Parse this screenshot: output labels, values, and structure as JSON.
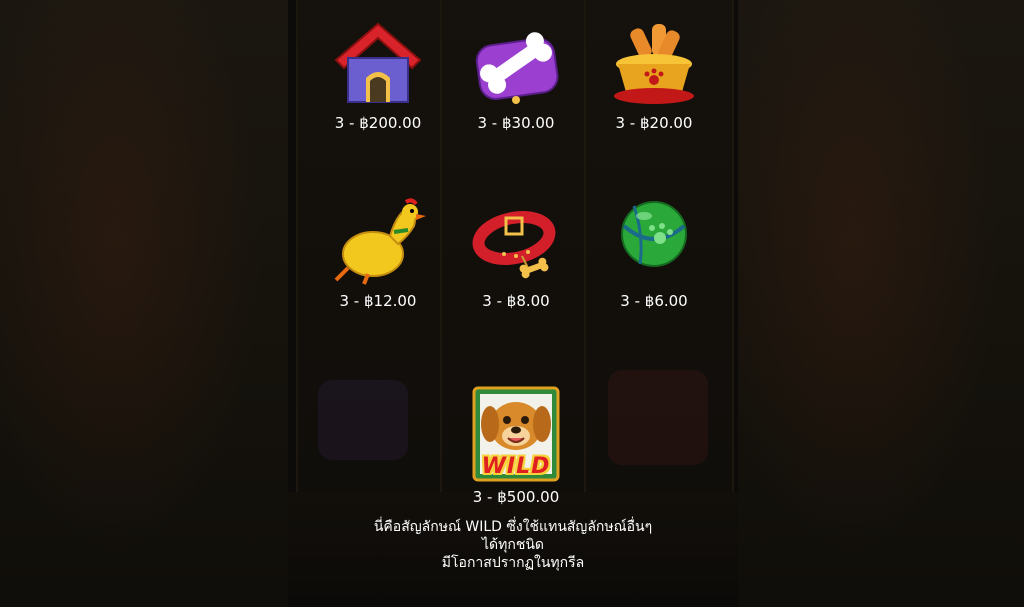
{
  "paytable": {
    "rows": [
      [
        {
          "icon": "dog-house-icon",
          "payout": "3 - ฿200.00"
        },
        {
          "icon": "bone-pillow-icon",
          "payout": "3 - ฿30.00"
        },
        {
          "icon": "dog-bowl-icon",
          "payout": "3 - ฿20.00"
        }
      ],
      [
        {
          "icon": "rubber-chicken-icon",
          "payout": "3 - ฿12.00"
        },
        {
          "icon": "dog-collar-icon",
          "payout": "3 - ฿8.00"
        },
        {
          "icon": "ball-icon",
          "payout": "3 - ฿6.00"
        }
      ]
    ],
    "wild": {
      "icon": "wild-dog-icon",
      "badge": "WILD",
      "payout": "3 - ฿500.00"
    }
  },
  "description": {
    "line1": "นี่คือสัญลักษณ์ WILD ซึ่งใช้แทนสัญลักษณ์อื่นๆ",
    "line2": "ได้ทุกชนิด",
    "line3": "มีโอกาสปรากฏในทุกรีล"
  },
  "colors": {
    "text": "#ffffff",
    "background": "#0b0a08"
  }
}
